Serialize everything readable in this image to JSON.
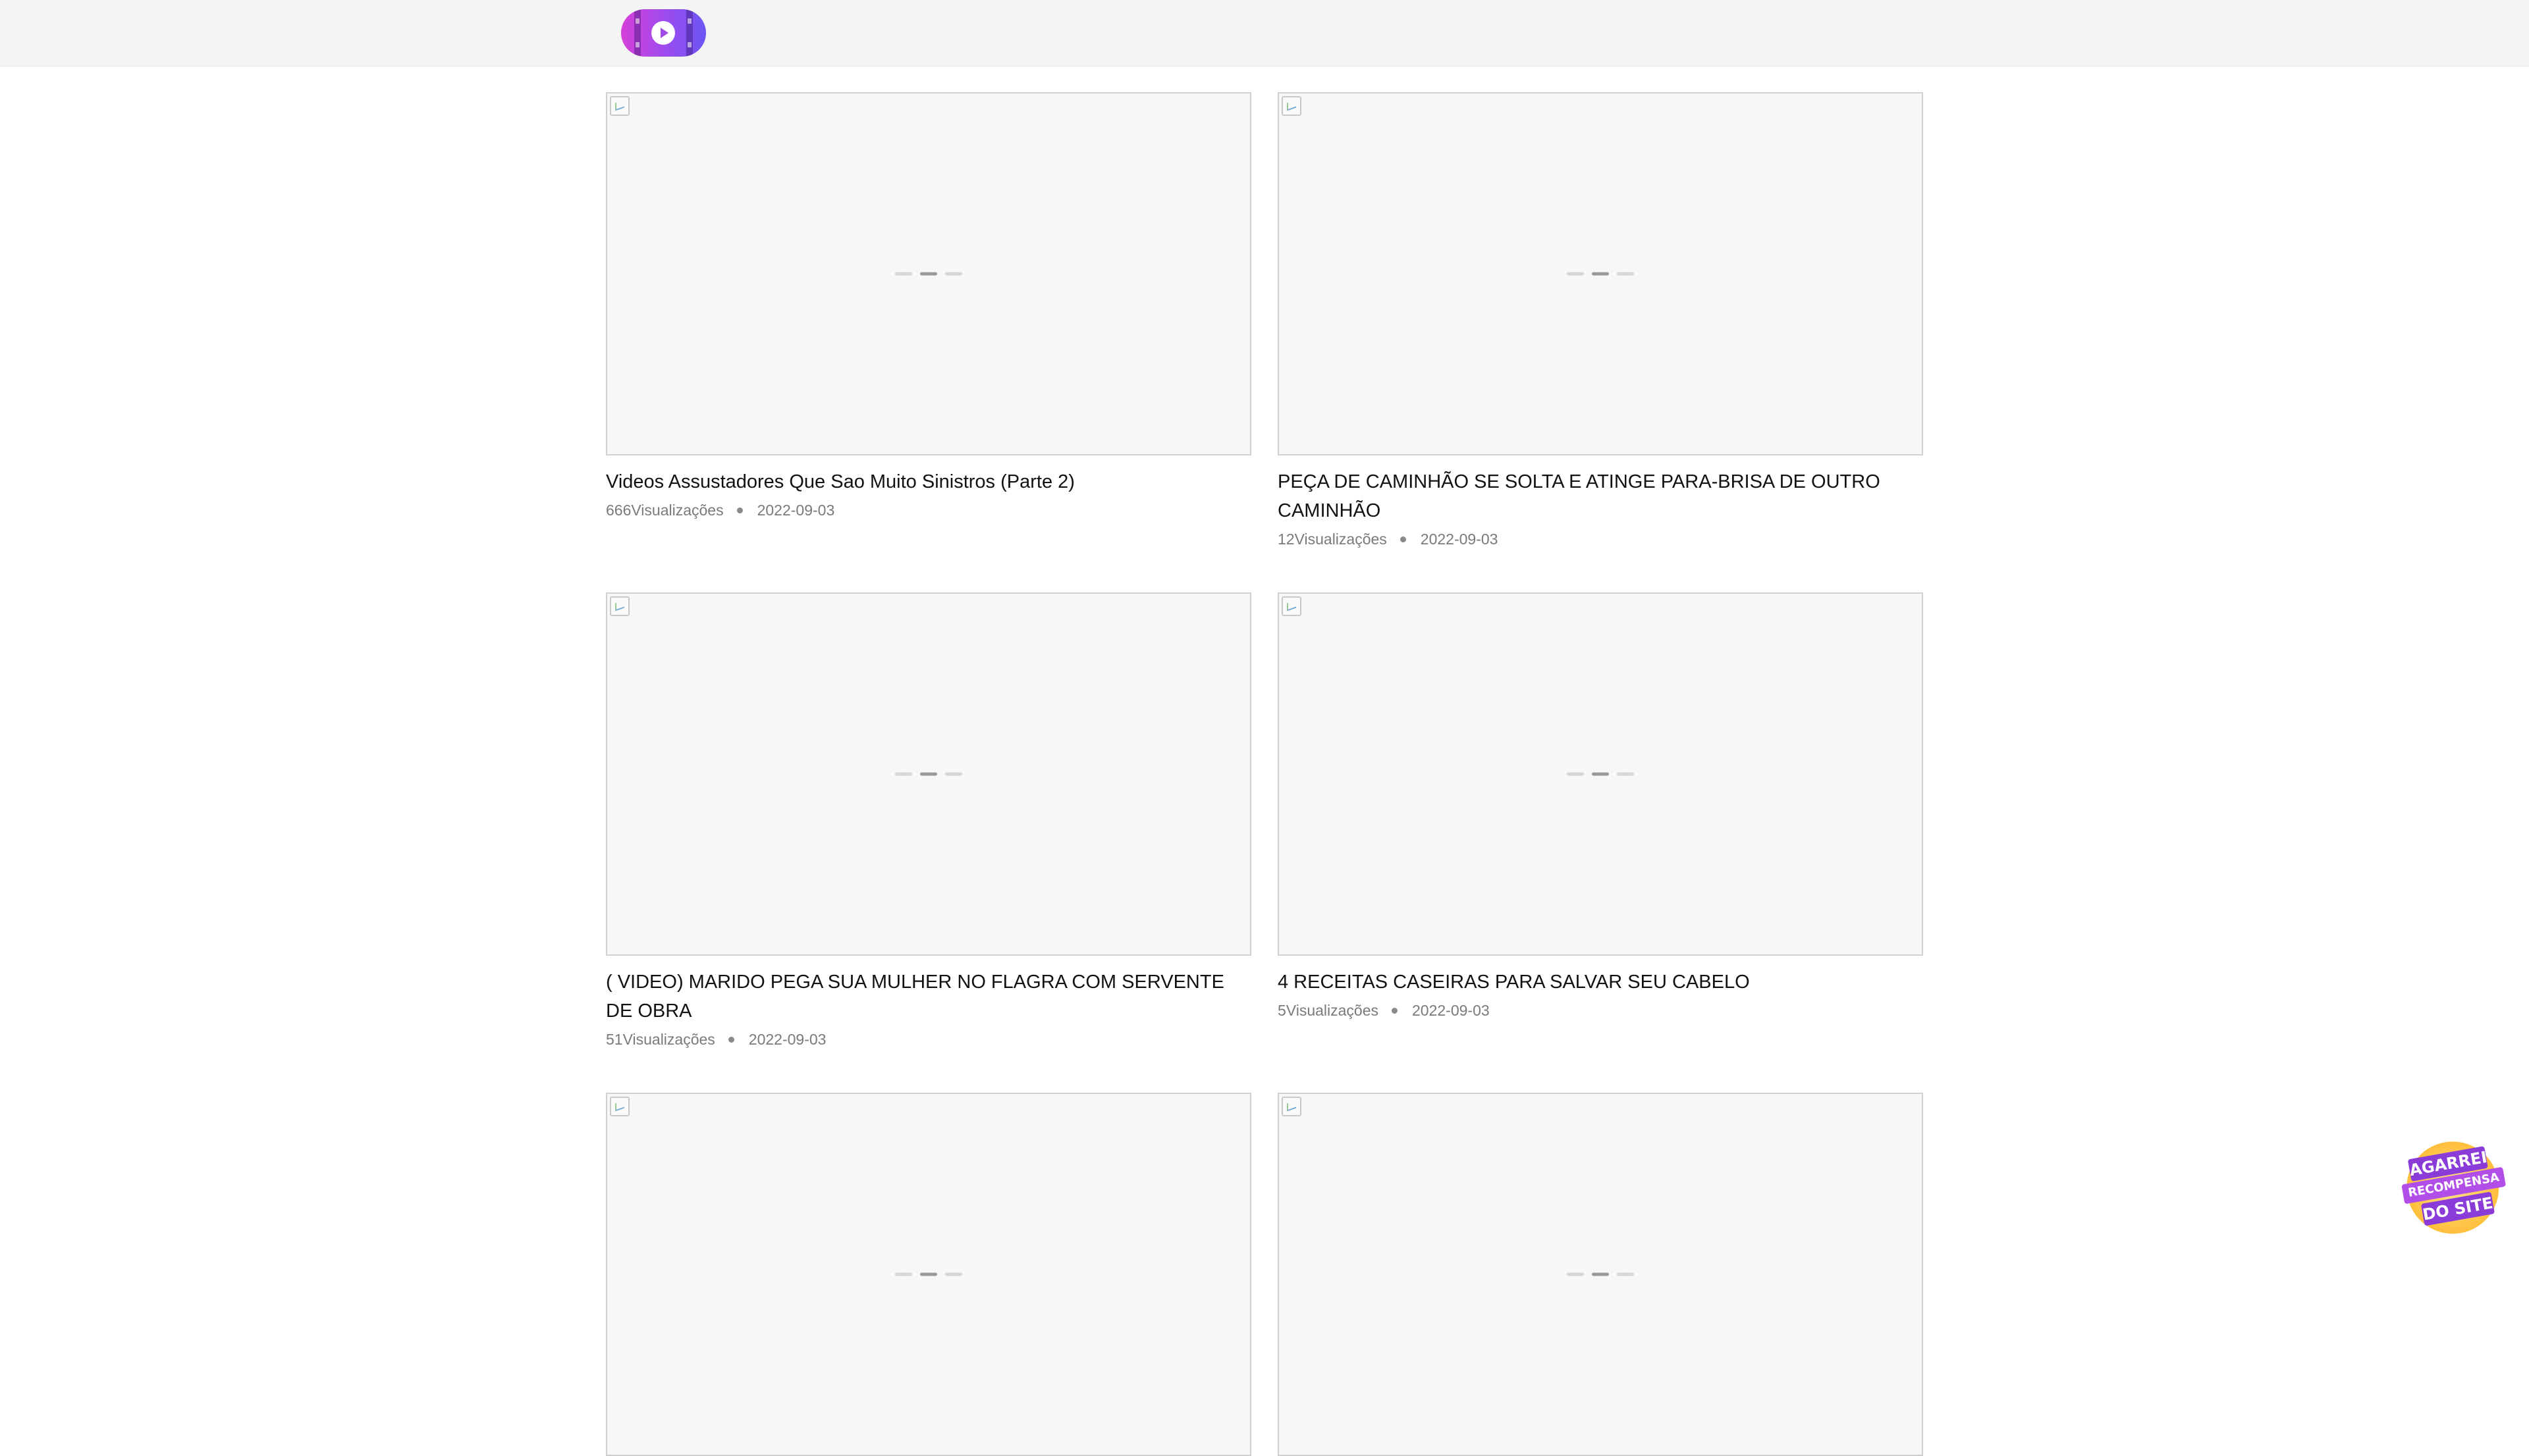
{
  "header": {
    "logo_icon": "video-play-logo",
    "logo_colors": [
      "#d63fd8",
      "#6c55f4"
    ]
  },
  "videos": [
    {
      "title": "Videos Assustadores Que Sao Muito Sinistros (Parte 2)",
      "views": "666Visualizações",
      "date": "2022-09-03"
    },
    {
      "title": "PEÇA DE CAMINHÃO SE SOLTA E ATINGE PARA-BRISA DE OUTRO CAMINHÃO",
      "views": "12Visualizações",
      "date": "2022-09-03"
    },
    {
      "title": "( VIDEO) MARIDO PEGA SUA MULHER NO FLAGRA COM SERVENTE DE OBRA",
      "views": "51Visualizações",
      "date": "2022-09-03"
    },
    {
      "title": "4 RECEITAS CASEIRAS PARA SALVAR SEU CABELO",
      "views": "5Visualizações",
      "date": "2022-09-03"
    },
    {
      "title": "",
      "views": "",
      "date": ""
    },
    {
      "title": "",
      "views": "",
      "date": ""
    }
  ],
  "reward_badge": {
    "line1": "AGARREI",
    "line2": "RECOMPENSA",
    "line3": "DO SITE",
    "accent": "#8a3bd8",
    "ring": "#ffbf3b"
  }
}
